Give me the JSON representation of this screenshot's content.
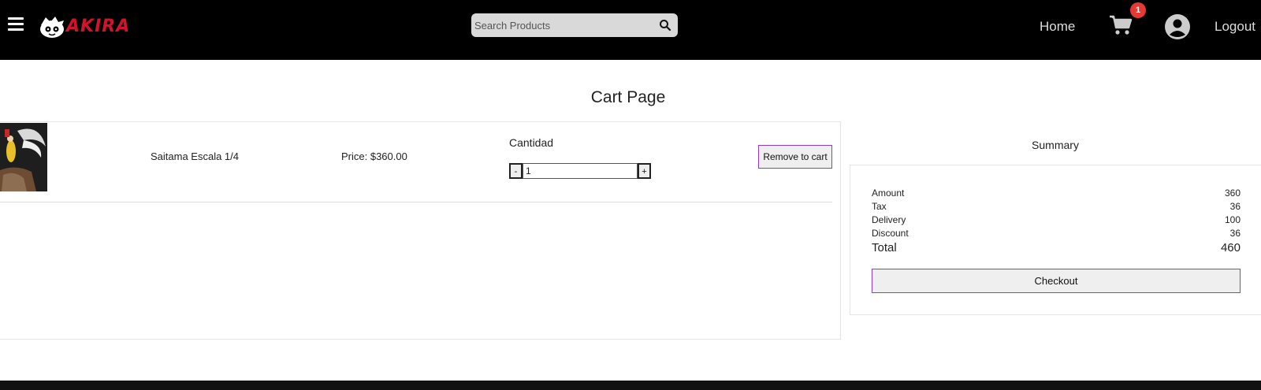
{
  "header": {
    "logo_text": "AKIRA",
    "search_placeholder": "Search Products",
    "search_value": "",
    "home_label": "Home",
    "cart_count": "1",
    "logout_label": "Logout"
  },
  "page": {
    "title": "Cart Page"
  },
  "cart": {
    "items": [
      {
        "name": "Saitama Escala 1/4",
        "price": "Price: $360.00",
        "qty_label": "Cantidad",
        "quantity": "1",
        "minus": "-",
        "plus": "+",
        "remove_label": "Remove to cart"
      }
    ]
  },
  "summary": {
    "title": "Summary",
    "rows": [
      {
        "label": "Amount",
        "value": "360"
      },
      {
        "label": "Tax",
        "value": "36"
      },
      {
        "label": "Delivery",
        "value": "100"
      },
      {
        "label": "Discount",
        "value": "36"
      }
    ],
    "total_label": "Total",
    "total_value": "460",
    "checkout_label": "Checkout"
  },
  "colors": {
    "header_bg": "#000000",
    "accent_border": "#8a3bd8",
    "badge": "#e53935",
    "logo_red": "#d3132a"
  },
  "icons": [
    "menu-icon",
    "search-icon",
    "cart-icon",
    "user-avatar-icon"
  ]
}
